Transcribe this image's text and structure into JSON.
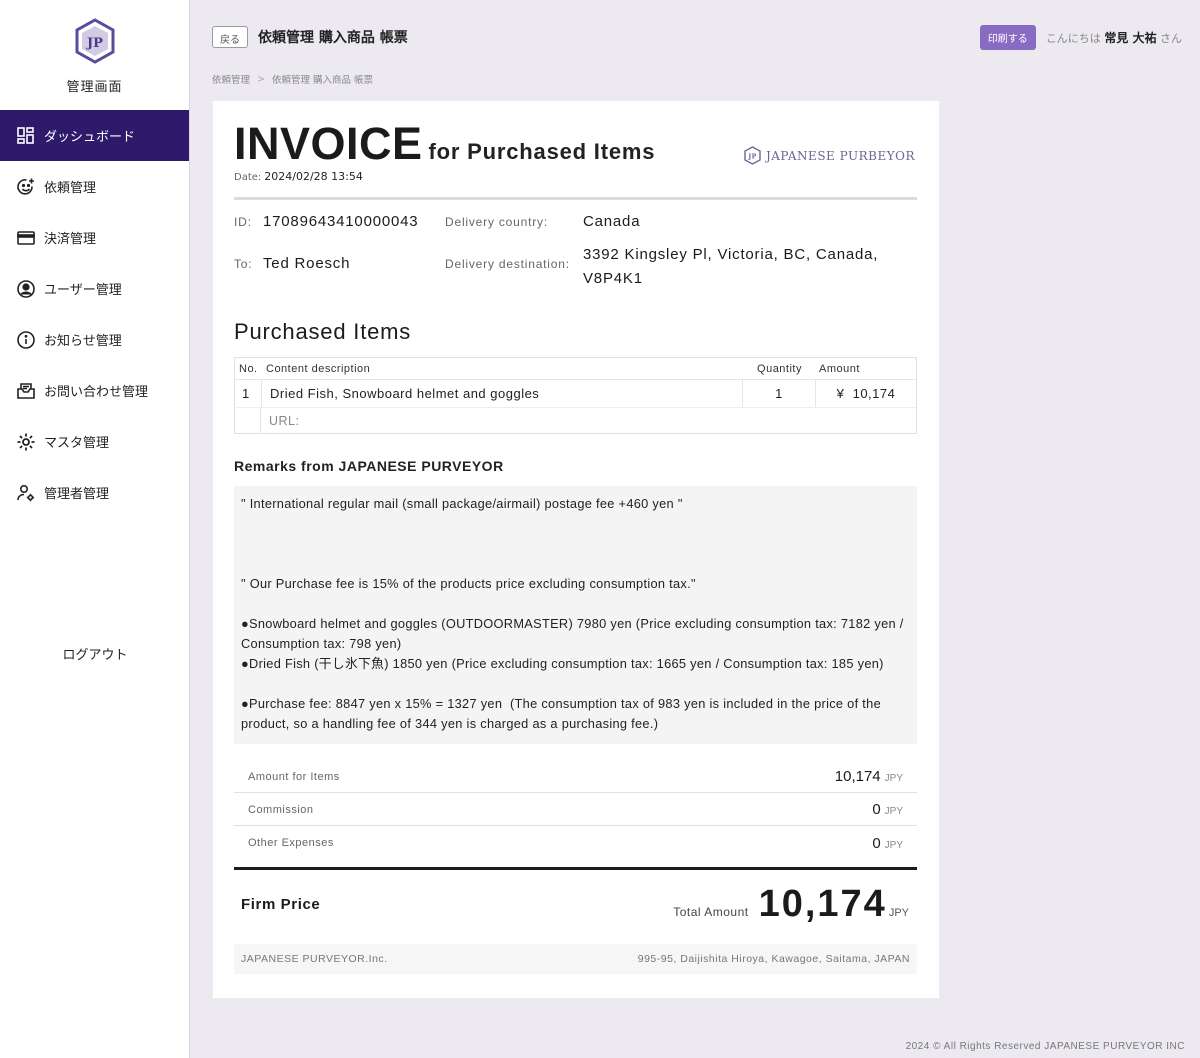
{
  "sidebar": {
    "title": "管理画面",
    "items": [
      {
        "label": "ダッシュボード",
        "icon": "dashboard-icon",
        "active": true
      },
      {
        "label": "依頼管理",
        "icon": "smile-plus-icon"
      },
      {
        "label": "決済管理",
        "icon": "credit-card-icon"
      },
      {
        "label": "ユーザー管理",
        "icon": "user-circle-icon"
      },
      {
        "label": "お知らせ管理",
        "icon": "info-icon"
      },
      {
        "label": "お問い合わせ管理",
        "icon": "mail-icon"
      },
      {
        "label": "マスタ管理",
        "icon": "gear-icon"
      },
      {
        "label": "管理者管理",
        "icon": "user-gear-icon"
      }
    ],
    "logout": "ログアウト"
  },
  "header": {
    "back": "戻る",
    "title": "依頼管理 購入商品 帳票",
    "print": "印刷する",
    "greeting_prefix": "こんにちは",
    "user_name": "常見 大祐",
    "greeting_suffix": "さん"
  },
  "breadcrumb": {
    "parent": "依頼管理",
    "current": "依頼管理 購入商品 帳票"
  },
  "invoice": {
    "title": "INVOICE",
    "subtitle": "for Purchased Items",
    "date_label": "Date:",
    "date": "2024/02/28 13:54",
    "brand": "JAPANESE PURBEYOR",
    "id_label": "ID:",
    "id": "17089643410000043",
    "to_label": "To:",
    "to": "Ted Roesch",
    "country_label": "Delivery country:",
    "country": "Canada",
    "destination_label": "Delivery destination:",
    "destination": "3392 Kingsley Pl, Victoria, BC, Canada, V8P4K1",
    "section_title": "Purchased Items",
    "columns": {
      "no": "No.",
      "desc": "Content description",
      "qty": "Quantity",
      "amount": "Amount"
    },
    "item": {
      "no": "1",
      "desc": "Dried Fish, Snowboard helmet and goggles",
      "qty": "1",
      "amount": "¥  10,174",
      "url_label": "URL:"
    },
    "remarks_title": "Remarks from JAPANESE PURVEYOR",
    "remarks": "\" International regular mail (small package/airmail) postage fee +460 yen \"\n\n\n\n\" Our Purchase fee is 15% of the products price excluding consumption tax.\"\n\n●Snowboard helmet and goggles (OUTDOORMASTER) 7980 yen (Price excluding consumption tax: 7182 yen / Consumption tax: 798 yen)\n●Dried Fish (干し氷下魚) 1850 yen (Price excluding consumption tax: 1665 yen / Consumption tax: 185 yen)\n\n●Purchase fee: 8847 yen x 15% = 1327 yen  (The consumption tax of 983 yen is included in the price of the product, so a handling fee of 344 yen is charged as a purchasing fee.)",
    "summary": [
      {
        "label": "Amount for Items",
        "value": "10,174",
        "currency": "JPY"
      },
      {
        "label": "Commission",
        "value": "0",
        "currency": "JPY"
      },
      {
        "label": "Other Expenses",
        "value": "0",
        "currency": "JPY"
      }
    ],
    "firm_label": "Firm Price",
    "total_label": "Total Amount",
    "total": "10,174",
    "total_currency": "JPY",
    "company": "JAPANESE PURVEYOR.Inc.",
    "address": "995-95, Daijishita Hiroya, Kawagoe, Saitama, JAPAN"
  },
  "copyright": "2024 © All Rights Reserved JAPANESE PURVEYOR INC"
}
